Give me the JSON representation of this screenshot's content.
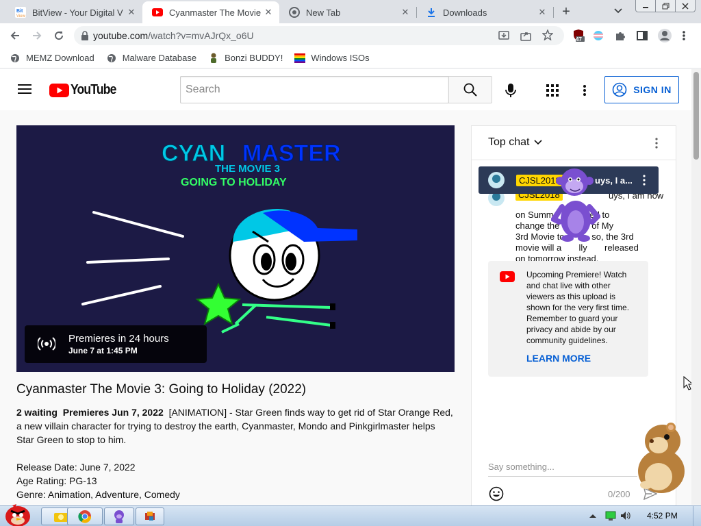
{
  "browser": {
    "tabs": [
      {
        "title": "BitView - Your Digital V",
        "icon": "bitview-icon"
      },
      {
        "title": "Cyanmaster The Movie",
        "icon": "youtube-icon",
        "active": true
      },
      {
        "title": "New Tab",
        "icon": "chrome-icon"
      },
      {
        "title": "Downloads",
        "icon": "download-icon"
      }
    ],
    "new_tab": "+",
    "url_host": "youtube.com",
    "url_path": "/watch?v=mvAJrQx_o6U",
    "extension_badge": "47",
    "bookmarks": [
      {
        "label": "MEMZ Download"
      },
      {
        "label": "Malware Database"
      },
      {
        "label": "Bonzi BUDDY!"
      },
      {
        "label": "Windows ISOs"
      }
    ]
  },
  "youtube": {
    "logo_text": "YouTube",
    "search_placeholder": "Search",
    "sign_in": "SIGN IN",
    "thumbnail": {
      "title_line1_a": "CYAN",
      "title_line1_b": "MASTER",
      "title_line2": "THE MOVIE 3",
      "title_line3": "GOING TO HOLIDAY"
    },
    "premiere_badge": {
      "title": "Premieres in 24 hours",
      "date": "June 7 at 1:45 PM"
    },
    "video_title": "Cyanmaster The Movie 3: Going to Holiday (2022)",
    "description": {
      "waiting": "2 waiting",
      "premieres": "Premieres Jun 7, 2022",
      "text": "[ANIMATION] - Star Green finds way to get rid of Star Orange Red, a new villain character for trying to destroy the earth, Cyanmaster, Mondo and Pinkgirlmaster helps Star Green to stop to him.",
      "release_date": "Release Date: June 7, 2022",
      "age_rating": "Age Rating: PG-13",
      "genre": "Genre: Animation, Adventure, Comedy"
    },
    "chat": {
      "header": "Top chat",
      "pinned_author": "CJSL2018",
      "pinned_preview": "uys, I a...",
      "message_author": "CJSL2018",
      "message_lines": [
        "uys, I am now",
        "on Summ      decided to",
        "change the       ate of My",
        "3rd Movie to       h, so, the 3rd",
        "movie will a       lly       released",
        "on tomorrow instead."
      ],
      "premiere_notice": "Upcoming Premiere! Watch and chat live with other viewers as this upload is shown for the very first time. Remember to guard your privacy and abide by our community guidelines.",
      "learn_more": "LEARN MORE",
      "input_placeholder": "Say something...",
      "char_count": "0/200"
    }
  },
  "taskbar": {
    "clock": "4:52 PM"
  },
  "colors": {
    "youtube_red": "#ff0000",
    "link_blue": "#065fd4",
    "thumb_bg": "#1c1a45",
    "cyan": "#00c8e6",
    "blue": "#0033ff",
    "green": "#33ff66"
  }
}
